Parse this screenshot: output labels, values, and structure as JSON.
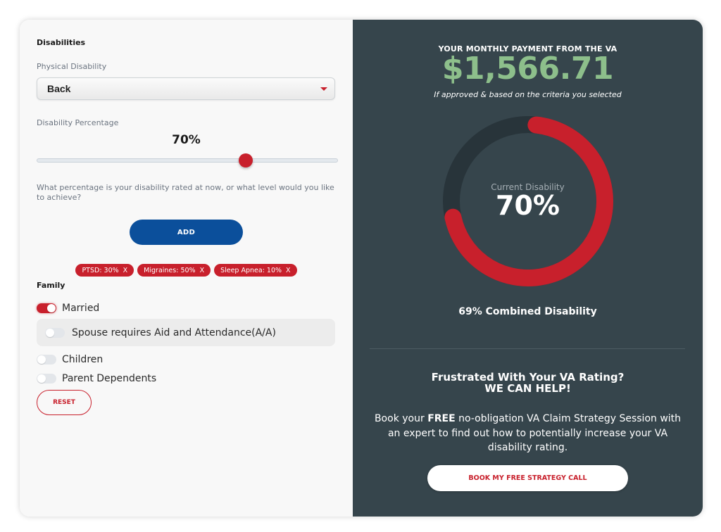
{
  "disabilities": {
    "section_title": "Disabilities",
    "physical_label": "Physical Disability",
    "physical_selected": "Back",
    "percentage_label": "Disability Percentage",
    "percentage_value": "70%",
    "slider_percent": 70,
    "help_text": "What percentage is your disability rated at now, or what level would you like to achieve?",
    "add_label": "ADD",
    "chips": [
      {
        "label": "PTSD: 30%",
        "remove": "X"
      },
      {
        "label": "Migraines: 50%",
        "remove": "X"
      },
      {
        "label": "Sleep Apnea: 10%",
        "remove": "X"
      }
    ]
  },
  "family": {
    "section_title": "Family",
    "married": {
      "label": "Married",
      "on": true
    },
    "spouse_aa": {
      "label": "Spouse requires Aid and Attendance(A/A)",
      "on": false
    },
    "children": {
      "label": "Children",
      "on": false
    },
    "parents": {
      "label": "Parent Dependents",
      "on": false
    },
    "reset_label": "RESET"
  },
  "results": {
    "payment_title": "YOUR MONTHLY PAYMENT FROM THE VA",
    "amount": "$1,566.71",
    "note": "If approved & based on the criteria you selected",
    "donut_label": "Current Disability",
    "donut_value": "70%",
    "donut_percent": 70,
    "combined": "69% Combined Disability"
  },
  "cta": {
    "title_line1": "Frustrated With Your VA Rating?",
    "title_line2": "WE CAN HELP!",
    "body_pre": "Book your ",
    "body_bold": "FREE",
    "body_post": " no-obligation VA Claim Strategy Session with an expert to find out how to potentially increase your VA disability rating.",
    "button_label": "BOOK MY FREE STRATEGY CALL"
  },
  "colors": {
    "accent_red": "#c8202c",
    "primary_blue": "#0b4f9b",
    "panel_dark": "#36454c",
    "money_green": "#8dbf8b"
  }
}
